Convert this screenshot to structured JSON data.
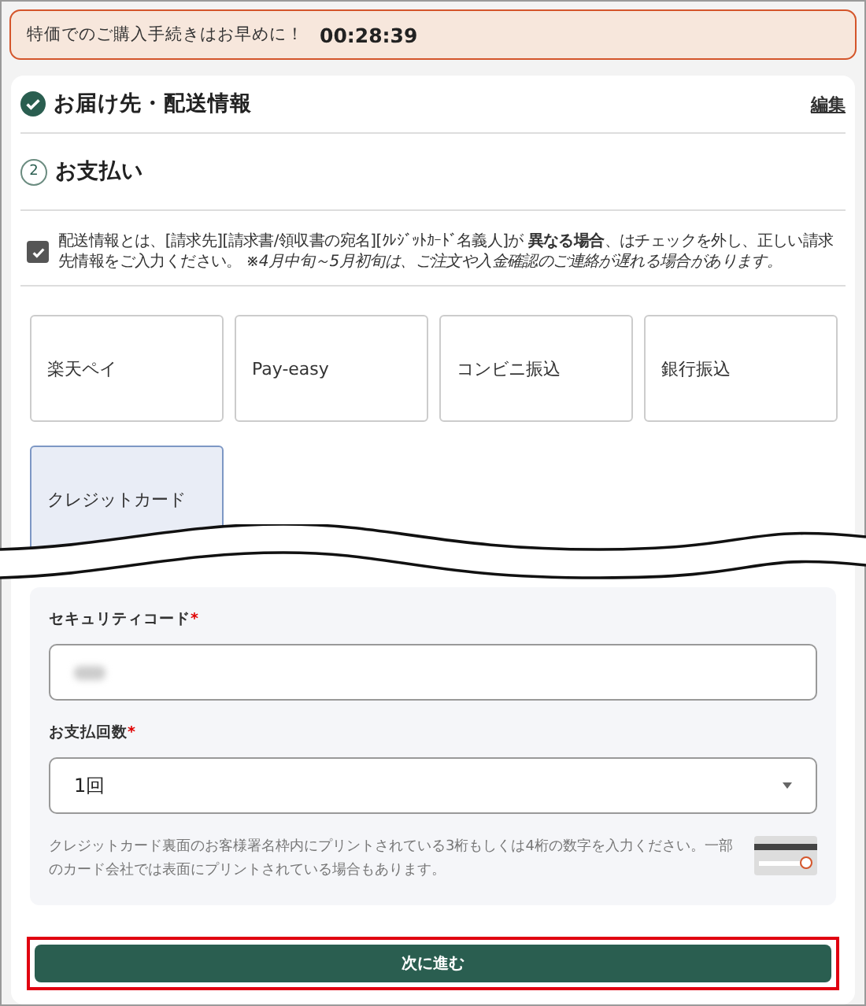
{
  "banner": {
    "message": "特価でのご購入手続きはお早めに！",
    "timer": "00:28:39"
  },
  "sections": [
    {
      "kind": "done",
      "title": "お届け先・配送情報",
      "action": "編集"
    },
    {
      "kind": "step",
      "number": "2",
      "title": "お支払い"
    }
  ],
  "notice": {
    "checked": true,
    "text": "配送情報とは、[請求先][請求書/領収書の宛名][ｸﾚｼﾞｯﾄｶｰﾄﾞ名義人]が **異なる場合**、はチェックを外し、正しい請求先情報をご入力ください。 *※4月中旬～5月初旬は、ご注文や入金確認のご連絡が遅れる場合があります。*"
  },
  "payment_options": [
    {
      "label": "楽天ペイ",
      "selected": false
    },
    {
      "label": "Pay-easy",
      "selected": false
    },
    {
      "label": "コンビニ振込",
      "selected": false
    },
    {
      "label": "銀行振込",
      "selected": false
    },
    {
      "label": "クレジットカード",
      "selected": true
    }
  ],
  "card_form": {
    "fields": [
      {
        "kind": "text",
        "label": "セキュリティコード",
        "required_mark": "*",
        "redacted": true
      },
      {
        "kind": "select",
        "label": "お支払回数",
        "required_mark": "*",
        "value": "1回"
      }
    ],
    "help": "クレジットカード裏面のお客様署名枠内にプリントされている3桁もしくは4桁の数字を入力ください。一部のカード会社では表面にプリントされている場合もあります。"
  },
  "next_button": {
    "label": "次に進む",
    "highlighted": true
  }
}
